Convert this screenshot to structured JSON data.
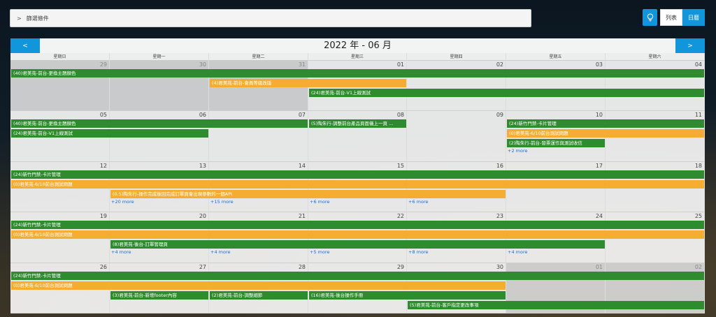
{
  "filter": {
    "label": "篩選條件",
    "chevron": ">"
  },
  "toolbar": {
    "list_label": "列表",
    "month_label": "日曆",
    "bulb_icon": "lightbulb-icon"
  },
  "calendar": {
    "title": "2022 年 - 06 月",
    "prev": "<",
    "next": ">",
    "weekdays": [
      "星期日",
      "星期一",
      "星期二",
      "星期三",
      "星期四",
      "星期五",
      "星期六"
    ],
    "weeks": [
      {
        "days": [
          {
            "n": "29",
            "other": true
          },
          {
            "n": "30",
            "other": true
          },
          {
            "n": "31",
            "other": true
          },
          {
            "n": "01"
          },
          {
            "n": "02"
          },
          {
            "n": "03"
          },
          {
            "n": "04"
          }
        ],
        "events": [
          {
            "t": "(40)君美苑-前台-更換主題顏色",
            "c": "g",
            "s": 0,
            "e": 6,
            "r": 0
          },
          {
            "t": "(4)君美苑-前台-會員等級改版",
            "c": "o",
            "s": 2,
            "e": 3,
            "r": 1
          },
          {
            "t": "(24)君美苑-前台-V1上線測試",
            "c": "g",
            "s": 3,
            "e": 6,
            "r": 2
          }
        ],
        "more": []
      },
      {
        "days": [
          {
            "n": "05"
          },
          {
            "n": "06"
          },
          {
            "n": "07"
          },
          {
            "n": "08"
          },
          {
            "n": "09"
          },
          {
            "n": "10"
          },
          {
            "n": "11"
          }
        ],
        "events": [
          {
            "t": "(40)君美苑-前台-更換主題顏色",
            "c": "g",
            "s": 0,
            "e": 2,
            "r": 0
          },
          {
            "t": "(5)陶朱行-調整前台產品頁面儀上一頁 ...",
            "c": "g",
            "s": 3,
            "e": 3,
            "r": 0
          },
          {
            "t": "(24)新竹門禁-卡片管理",
            "c": "g",
            "s": 5,
            "e": 6,
            "r": 0
          },
          {
            "t": "(24)君美苑-前台-V1上線測試",
            "c": "g",
            "s": 0,
            "e": 1,
            "r": 1
          },
          {
            "t": "(0)君美苑-6/10前台測試問題",
            "c": "o",
            "s": 5,
            "e": 6,
            "r": 1
          },
          {
            "t": "(2)陶朱行-前台-發票運作與測試收信",
            "c": "g",
            "s": 5,
            "e": 5,
            "r": 2
          }
        ],
        "more": [
          {
            "t": "+2 more",
            "d": 5,
            "r": 3
          }
        ]
      },
      {
        "days": [
          {
            "n": "12"
          },
          {
            "n": "13"
          },
          {
            "n": "14"
          },
          {
            "n": "15"
          },
          {
            "n": "16"
          },
          {
            "n": "17"
          },
          {
            "n": "18"
          }
        ],
        "events": [
          {
            "t": "(24)新竹門禁-卡片管理",
            "c": "g",
            "s": 0,
            "e": 6,
            "r": 0
          },
          {
            "t": "(0)君美苑-6/10前台測試問題",
            "c": "o",
            "s": 0,
            "e": 6,
            "r": 1
          },
          {
            "t": "(0.5)陶朱行-操作完成後回完成訂單頁會出現參數的一個API",
            "c": "o",
            "s": 1,
            "e": 4,
            "r": 2
          }
        ],
        "more": [
          {
            "t": "+20 more",
            "d": 1,
            "r": 3
          },
          {
            "t": "+15 more",
            "d": 2,
            "r": 3
          },
          {
            "t": "+6 more",
            "d": 3,
            "r": 3
          },
          {
            "t": "+6 more",
            "d": 4,
            "r": 3
          }
        ]
      },
      {
        "days": [
          {
            "n": "19"
          },
          {
            "n": "20"
          },
          {
            "n": "21"
          },
          {
            "n": "22"
          },
          {
            "n": "23"
          },
          {
            "n": "24"
          },
          {
            "n": "25"
          }
        ],
        "events": [
          {
            "t": "(24)新竹門禁-卡片管理",
            "c": "g",
            "s": 0,
            "e": 6,
            "r": 0
          },
          {
            "t": "(0)君美苑-6/10前台測試問題",
            "c": "o",
            "s": 0,
            "e": 6,
            "r": 1
          },
          {
            "t": "(8)君美苑-後台-訂單管理頁",
            "c": "g",
            "s": 1,
            "e": 5,
            "r": 2
          }
        ],
        "more": [
          {
            "t": "+4 more",
            "d": 1,
            "r": 3
          },
          {
            "t": "+4 more",
            "d": 2,
            "r": 3
          },
          {
            "t": "+5 more",
            "d": 3,
            "r": 3
          },
          {
            "t": "+8 more",
            "d": 4,
            "r": 3
          },
          {
            "t": "+4 more",
            "d": 5,
            "r": 3
          }
        ]
      },
      {
        "days": [
          {
            "n": "26"
          },
          {
            "n": "27"
          },
          {
            "n": "28"
          },
          {
            "n": "29"
          },
          {
            "n": "30"
          },
          {
            "n": "01",
            "other": true
          },
          {
            "n": "02",
            "other": true
          }
        ],
        "events": [
          {
            "t": "(24)新竹門禁-卡片管理",
            "c": "g",
            "s": 0,
            "e": 6,
            "r": 0
          },
          {
            "t": "(0)君美苑-6/10前台測試問題",
            "c": "o",
            "s": 0,
            "e": 4,
            "r": 1
          },
          {
            "t": "(3)君美苑-前台-新增footer內容",
            "c": "g",
            "s": 1,
            "e": 1,
            "r": 2
          },
          {
            "t": "(2)君美苑-前台-調整細節",
            "c": "g",
            "s": 2,
            "e": 2,
            "r": 2
          },
          {
            "t": "(16)君美苑-後台操作手冊",
            "c": "g",
            "s": 3,
            "e": 4,
            "r": 2
          },
          {
            "t": "(5)君美苑-前台-客戶指定更改事項",
            "c": "g",
            "s": 4,
            "e": 6,
            "r": 3
          }
        ],
        "more": []
      }
    ]
  }
}
